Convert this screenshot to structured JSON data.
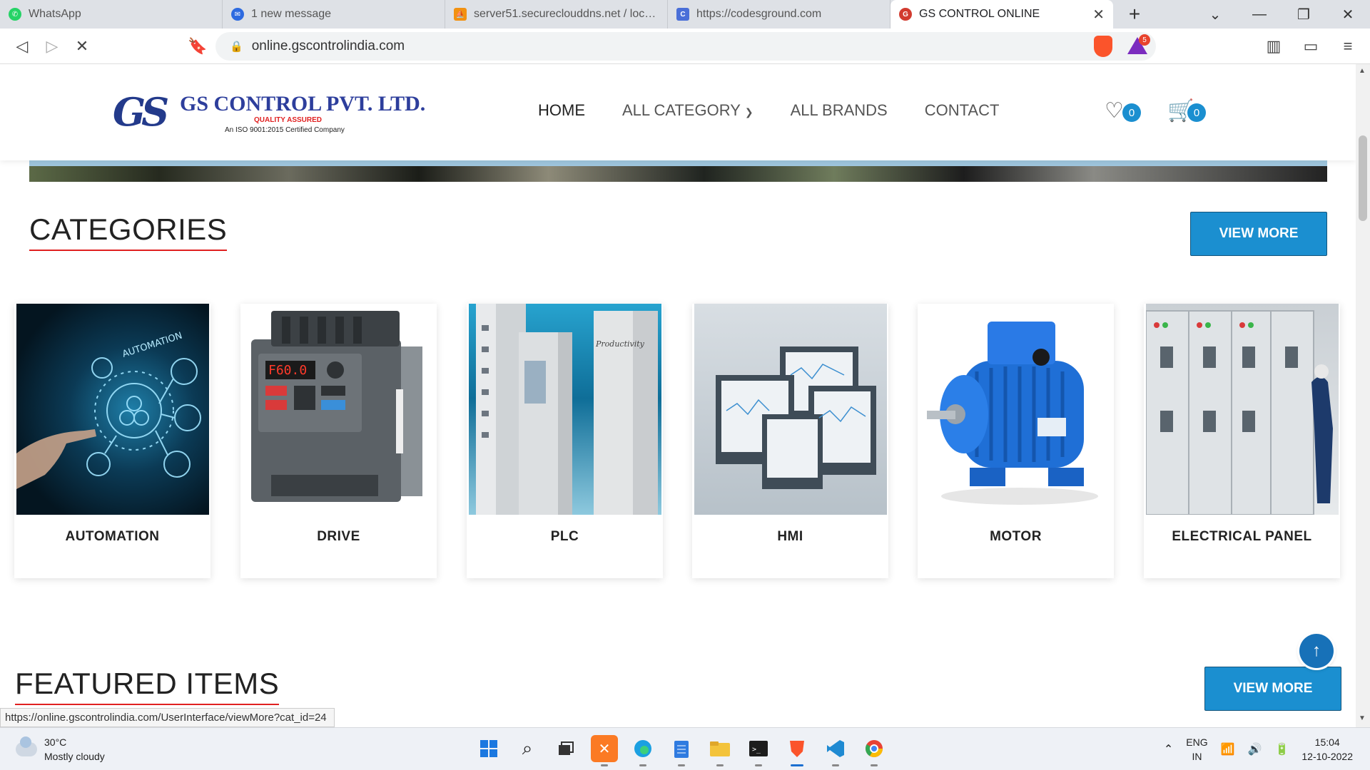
{
  "browser": {
    "tabs": [
      {
        "title": "WhatsApp",
        "icon": "whatsapp-icon",
        "color": "#25d366",
        "active": false
      },
      {
        "title": "1 new message",
        "icon": "messenger-icon",
        "color": "#2d6ae0",
        "active": false
      },
      {
        "title": "server51.secureclouddns.net / localhost",
        "icon": "phpmyadmin-icon",
        "color": "#f29111",
        "active": false
      },
      {
        "title": "https://codesground.com",
        "icon": "codesground-icon",
        "color": "#4a6fd8",
        "active": false
      },
      {
        "title": "GS CONTROL ONLINE",
        "icon": "gs-control-icon",
        "color": "#d23b2f",
        "active": true
      }
    ],
    "url": "online.gscontrolindia.com",
    "rewards_badge": "5",
    "status_url": "https://online.gscontrolindia.com/UserInterface/viewMore?cat_id=24"
  },
  "site": {
    "logo": {
      "mark": "GS",
      "name": "GS CONTROL  PVT. LTD.",
      "tagline": "QUALITY  ASSURED",
      "iso": "An  ISO  9001:2015  Certified Company"
    },
    "nav": {
      "home": "HOME",
      "all_category": "ALL CATEGORY",
      "all_brands": "ALL BRANDS",
      "contact": "CONTACT"
    },
    "wishlist_count": "0",
    "cart_count": "0",
    "accent": "#1b8fd0"
  },
  "categories": {
    "title": "CATEGORIES",
    "view_more": "VIEW MORE",
    "items": [
      {
        "label": "AUTOMATION"
      },
      {
        "label": "DRIVE"
      },
      {
        "label": "PLC"
      },
      {
        "label": "HMI"
      },
      {
        "label": "MOTOR"
      },
      {
        "label": "ELECTRICAL PANEL"
      }
    ],
    "drive_display": "F60.0"
  },
  "featured": {
    "title": "FEATURED ITEMS",
    "view_more": "VIEW MORE"
  },
  "taskbar": {
    "temperature": "30°C",
    "weather": "Mostly cloudy",
    "lang_top": "ENG",
    "lang_bottom": "IN",
    "time": "15:04",
    "date": "12-10-2022"
  }
}
